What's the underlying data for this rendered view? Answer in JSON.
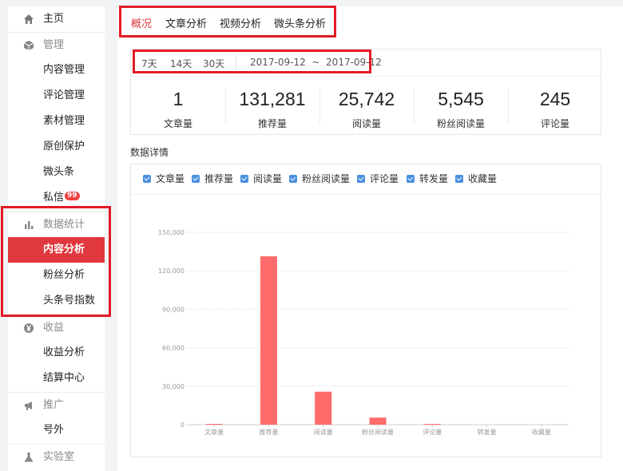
{
  "sidebar": {
    "home": "主页",
    "manage": {
      "label": "管理",
      "items": [
        "内容管理",
        "评论管理",
        "素材管理",
        "原创保护",
        "微头条"
      ],
      "messages": "私信",
      "messages_badge": "99"
    },
    "stats": {
      "label": "数据统计",
      "items": [
        "内容分析",
        "粉丝分析",
        "头条号指数"
      ],
      "active": "内容分析"
    },
    "income": {
      "label": "收益",
      "items": [
        "收益分析",
        "结算中心"
      ]
    },
    "promote": {
      "label": "推广",
      "items": [
        "号外"
      ]
    },
    "lab": "实验室"
  },
  "tabs": [
    "概况",
    "文章分析",
    "视频分析",
    "微头条分析"
  ],
  "active_tab": "概况",
  "date_filter": {
    "ranges": [
      "7天",
      "14天",
      "30天"
    ],
    "date_range": "2017-09-12  ~  2017-09-12"
  },
  "summary": [
    {
      "value": "1",
      "label": "文章量"
    },
    {
      "value": "131,281",
      "label": "推荐量"
    },
    {
      "value": "25,742",
      "label": "阅读量"
    },
    {
      "value": "5,545",
      "label": "粉丝阅读量"
    },
    {
      "value": "245",
      "label": "评论量"
    }
  ],
  "details_title": "数据详情",
  "legend": [
    "文章量",
    "推荐量",
    "阅读量",
    "粉丝阅读量",
    "评论量",
    "转发量",
    "收藏量"
  ],
  "colors": {
    "accent": "#e0383e",
    "bar": "#ff6b6b",
    "checkbox": "#4a90e2",
    "annotation": "#e21b25"
  },
  "chart_data": {
    "type": "bar",
    "categories": [
      "文章量",
      "推荐量",
      "阅读量",
      "粉丝阅读量",
      "评论量",
      "转发量",
      "收藏量"
    ],
    "values": [
      1,
      131281,
      25742,
      5545,
      245,
      0,
      0
    ],
    "yticks": [
      "0",
      "30,000",
      "60,000",
      "90,000",
      "120,000",
      "150,000"
    ],
    "ylim": [
      0,
      150000
    ],
    "grid": true
  }
}
